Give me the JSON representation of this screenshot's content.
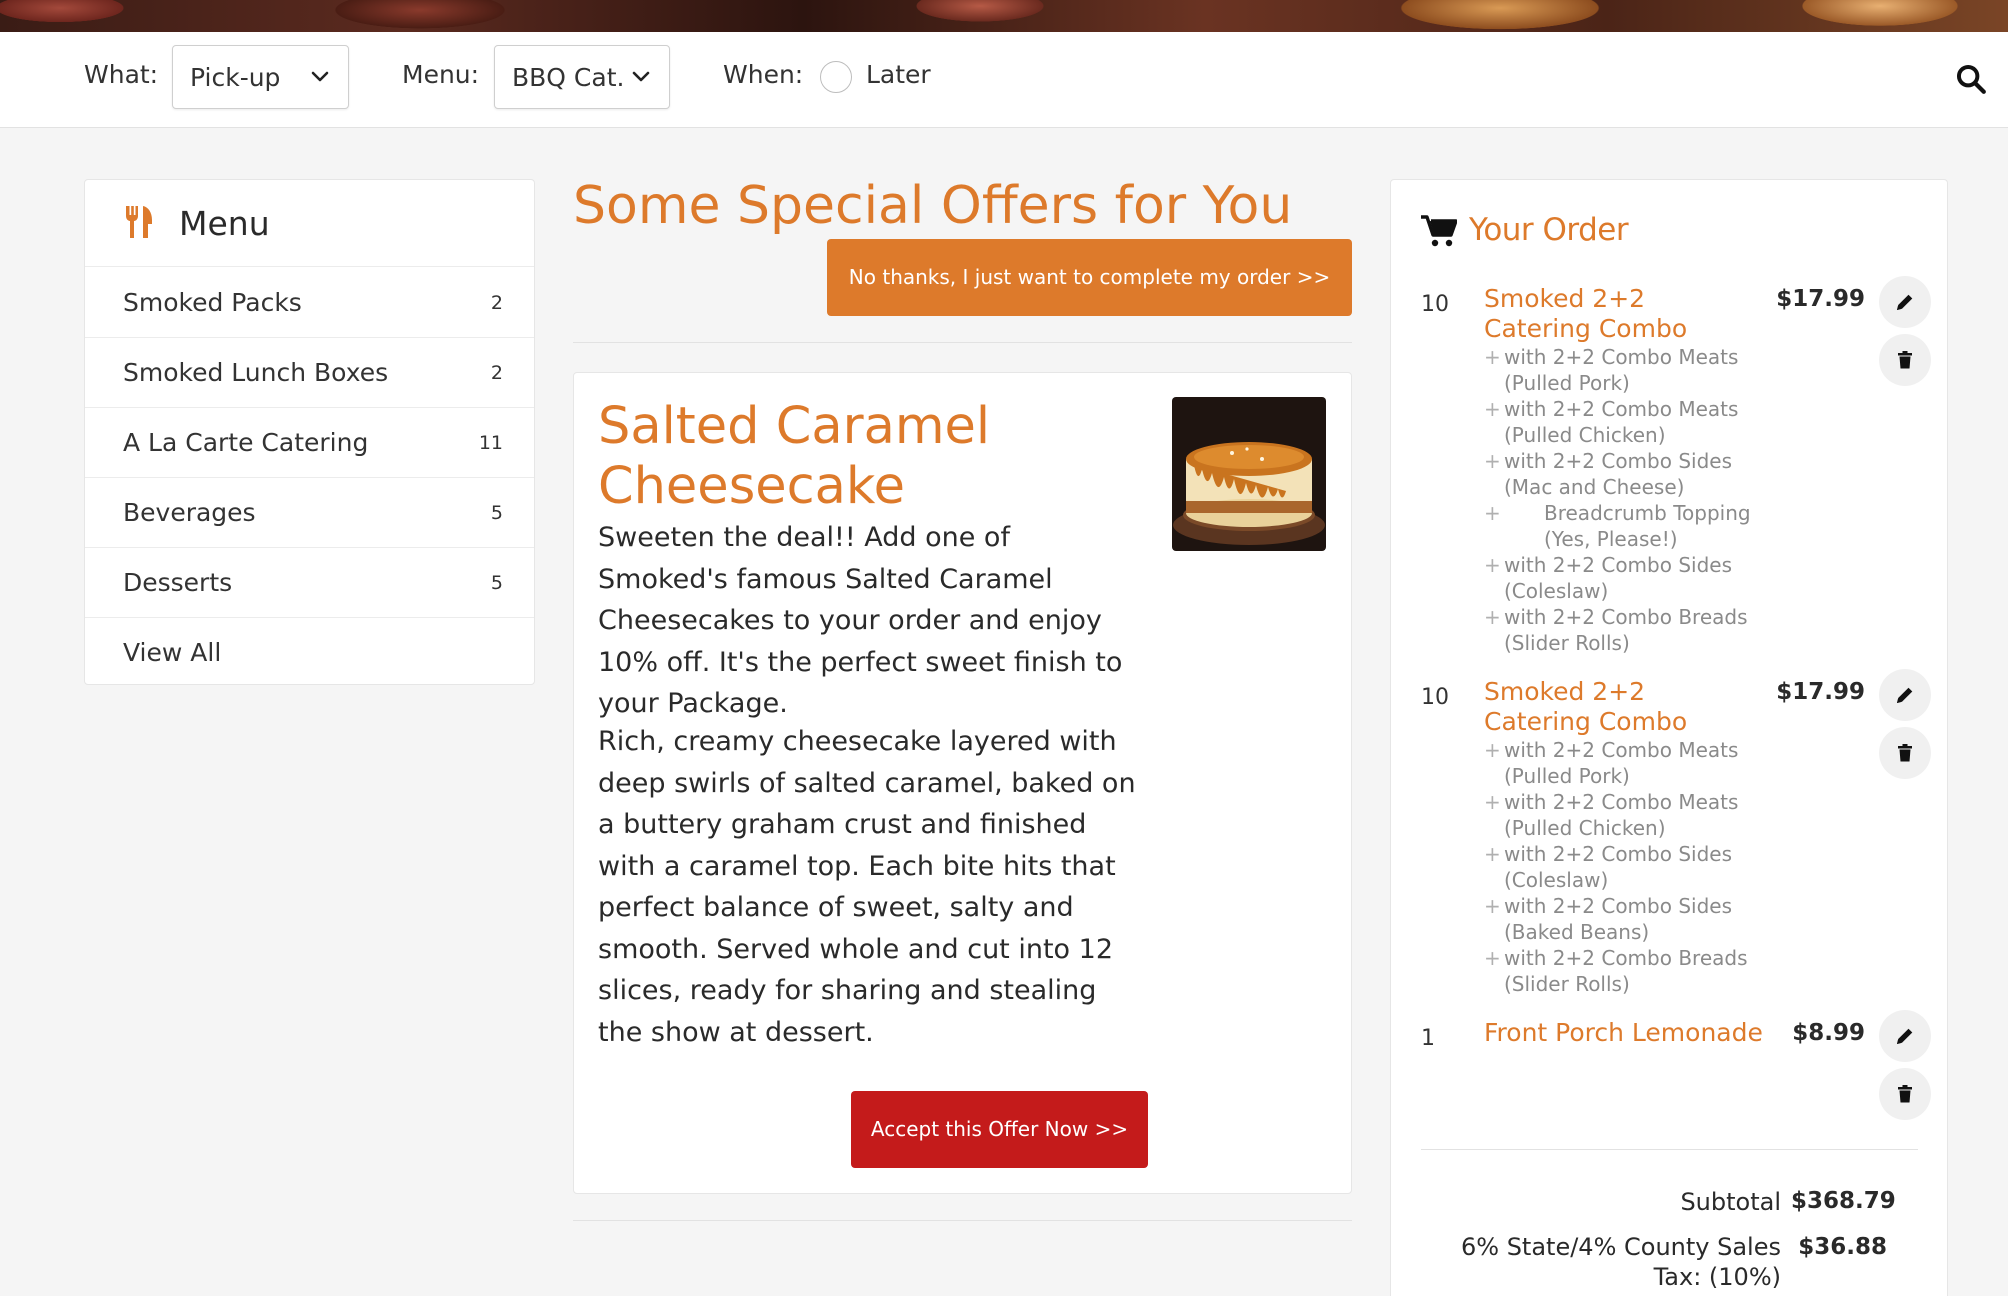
{
  "filters": {
    "what_label": "What:",
    "what_value": "Pick-up",
    "menu_label": "Menu:",
    "menu_value": "BBQ Cat...",
    "when_label": "When:",
    "when_option": "Later"
  },
  "menu": {
    "title": "Menu",
    "items": [
      {
        "label": "Smoked Packs",
        "count": "2"
      },
      {
        "label": "Smoked Lunch Boxes",
        "count": "2"
      },
      {
        "label": "A La Carte Catering",
        "count": "11"
      },
      {
        "label": "Beverages",
        "count": "5"
      },
      {
        "label": "Desserts",
        "count": "5"
      },
      {
        "label": "View All",
        "count": ""
      }
    ]
  },
  "offers": {
    "title": "Some Special Offers for You",
    "no_thanks": "No thanks, I just want to complete my order >>",
    "offer": {
      "name": "Salted Caramel Cheesecake",
      "description_1": "Sweeten the deal!! Add one of Smoked's famous Salted Caramel Cheesecakes to your order and enjoy 10% off. It's the perfect sweet finish to your Package.",
      "description_2": "Rich, creamy cheesecake layered with deep swirls of salted caramel, baked on a buttery graham crust and finished with a caramel top. Each bite hits that perfect balance of sweet, salty and smooth. Served whole and cut into 12 slices, ready for sharing and stealing the show at dessert.",
      "accept": "Accept this Offer Now >>"
    }
  },
  "order": {
    "title": "Your Order",
    "items": [
      {
        "qty": "10",
        "name": "Smoked 2+2 Catering Combo",
        "price": "$17.99",
        "modifiers": [
          "with 2+2 Combo Meats (Pulled Pork)",
          "with 2+2 Combo Meats (Pulled Chicken)",
          "with 2+2 Combo Sides (Mac and Cheese)",
          "Breadcrumb Topping (Yes, Please!)",
          "with 2+2 Combo Sides (Coleslaw)",
          "with 2+2 Combo Breads (Slider Rolls)"
        ]
      },
      {
        "qty": "10",
        "name": "Smoked 2+2 Catering Combo",
        "price": "$17.99",
        "modifiers": [
          "with 2+2 Combo Meats (Pulled Pork)",
          "with 2+2 Combo Meats (Pulled Chicken)",
          "with 2+2 Combo Sides (Coleslaw)",
          "with 2+2 Combo Sides (Baked Beans)",
          "with 2+2 Combo Breads (Slider Rolls)"
        ]
      },
      {
        "qty": "1",
        "name": "Front Porch Lemonade",
        "price": "$8.99",
        "modifiers": []
      }
    ],
    "subtotal_label": "Subtotal",
    "subtotal_value": "$368.79",
    "tax_label": "6% State/4% County Sales Tax: (10%)",
    "tax_value": "$36.88"
  },
  "colors": {
    "accent": "#dd7a2b",
    "accept": "#c41b1b"
  },
  "icons": {
    "menu": "utensils-icon",
    "order": "cart-icon",
    "edit": "pencil-icon",
    "delete": "trash-icon",
    "search": "search-icon",
    "select": "chevron-down-icon"
  }
}
